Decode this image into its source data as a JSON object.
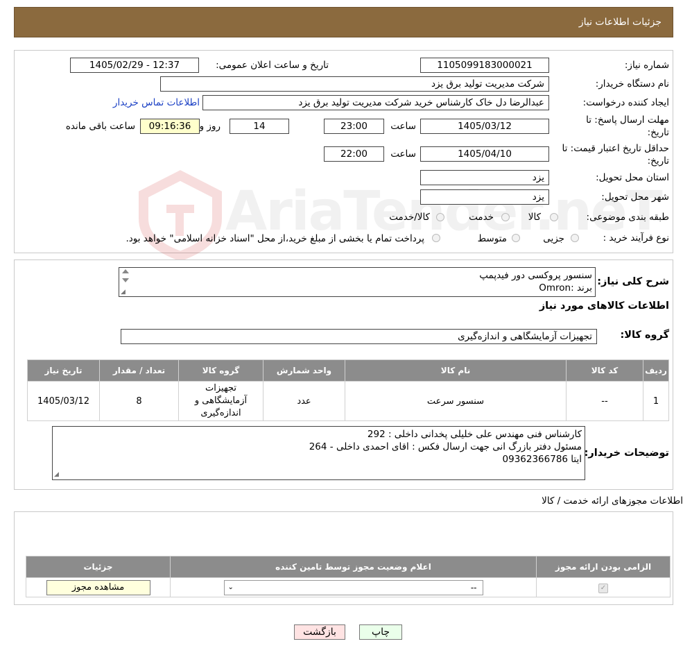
{
  "header": {
    "title": "جزئیات اطلاعات نیاز"
  },
  "form": {
    "need_number_label": "شماره نیاز:",
    "need_number": "1105099183000021",
    "announce_label": "تاریخ و ساعت اعلان عمومی:",
    "announce_value": "1405/02/29 - 12:37",
    "buyer_org_label": "نام دستگاه خریدار:",
    "buyer_org": "شرکت مدیریت تولید برق یزد",
    "requester_label": "ایجاد کننده درخواست:",
    "requester": "عبدالرضا دل خاک کارشناس خرید شرکت مدیریت تولید برق یزد",
    "contact_link": "اطلاعات تماس خریدار",
    "deadline_label_1": "مهلت ارسال پاسخ: تا",
    "deadline_label_2": "تاریخ:",
    "deadline_date": "1405/03/12",
    "time_label": "ساعت",
    "deadline_time": "23:00",
    "days_value": "14",
    "days_label": "روز و",
    "remaining_time": "09:16:36",
    "remaining_label": "ساعت باقی مانده",
    "validity_label_1": "حداقل تاریخ اعتبار قیمت: تا",
    "validity_label_2": "تاریخ:",
    "validity_date": "1405/04/10",
    "validity_time": "22:00",
    "province_label": "استان محل تحویل:",
    "province": "یزد",
    "city_label": "شهر محل تحویل:",
    "city": "یزد",
    "category_label": "طبقه بندی موضوعی:",
    "category_options": [
      "کالا",
      "خدمت",
      "کالا/خدمت"
    ],
    "process_label": "نوع فرآیند خرید :",
    "process_options": [
      "جزیی",
      "متوسط"
    ],
    "process_note": "پرداخت تمام یا بخشی از مبلغ خرید،از محل \"اسناد خزانه اسلامی\" خواهد بود."
  },
  "summary": {
    "label": "شرح کلی نیاز:",
    "line1": "سنسور پروکسی دور فیدپمپ",
    "line2": "برند :Omron"
  },
  "goods": {
    "section_title": "اطلاعات کالاهای مورد نیاز",
    "group_label": "گروه کالا:",
    "group_value": "تجهیزات آزمایشگاهی و اندازه‌گیری",
    "columns": [
      "ردیف",
      "کد کالا",
      "نام کالا",
      "واحد شمارش",
      "گروه کالا",
      "تعداد / مقدار",
      "تاریخ نیاز"
    ],
    "rows": [
      {
        "row": "1",
        "code": "--",
        "name": "سنسور سرعت",
        "unit": "عدد",
        "group": "تجهیزات آزمایشگاهی و اندازه‌گیری",
        "qty": "8",
        "date": "1405/03/12"
      }
    ]
  },
  "buyer_notes": {
    "label": "توضیحات خریدار:",
    "line1": "کارشناس فنی مهندس علی خلیلی پخدانی داخلی : 292",
    "line2": "مسئول دفتر بازرگ انی جهت ارسال فکس : اقای احمدی داخلی - 264",
    "line3": "ایتا 09362366786"
  },
  "licenses": {
    "section_title": "اطلاعات مجوزهای ارائه خدمت / کالا",
    "columns": [
      "الزامی بودن ارائه مجوز",
      "اعلام وضعیت مجوز توسط تامین کننده",
      "جزئیات"
    ],
    "select_value": "--",
    "view_button": "مشاهده مجوز"
  },
  "buttons": {
    "print": "چاپ",
    "back": "بازگشت"
  },
  "watermark": {
    "text": "AriaTender.neT"
  }
}
